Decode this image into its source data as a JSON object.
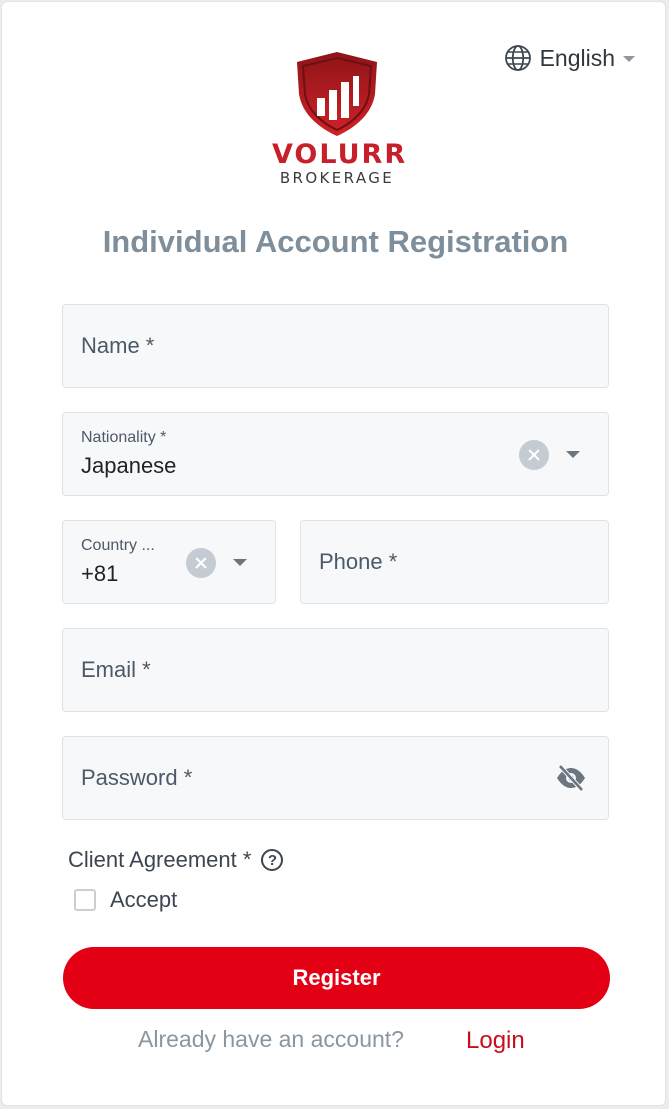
{
  "header": {
    "language": "English"
  },
  "logo": {
    "brand": "VOLURR",
    "sub": "BROKERAGE"
  },
  "page_title": "Individual Account Registration",
  "form": {
    "name_placeholder": "Name *",
    "nationality_label": "Nationality *",
    "nationality_value": "Japanese",
    "country_label": "Country ...",
    "country_value": "+81",
    "phone_placeholder": "Phone *",
    "email_placeholder": "Email *",
    "password_placeholder": "Password *",
    "agreement_label": "Client Agreement *",
    "help_glyph": "?",
    "accept_label": "Accept",
    "register_label": "Register"
  },
  "footer": {
    "prompt": "Already have an account?",
    "login_label": "Login"
  },
  "colors": {
    "brand_red": "#e30015",
    "title_gray": "#7e8e9a",
    "field_bg": "#f7f8fa"
  },
  "icons": [
    "globe-icon",
    "chevron-down-icon",
    "shield-logo",
    "clear-icon",
    "eye-off-icon",
    "help-icon"
  ]
}
